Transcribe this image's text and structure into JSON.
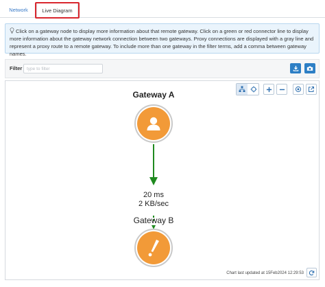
{
  "tabs": [
    {
      "label": "Network"
    },
    {
      "label": "Live Diagram"
    }
  ],
  "info": {
    "text": "Click on a gateway node to display more information about that remote gateway. Click on a green or red connector line to display more information about the gateway network connection between two gateways. Proxy connections are displayed with a gray line and represent a proxy route to a remote gateway. To include more than one gateway in the filter terms, add a comma between gateway names."
  },
  "filter": {
    "label": "Filter",
    "placeholder": "type to filter",
    "value": ""
  },
  "diagram": {
    "nodes": [
      {
        "name": "Gateway A",
        "icon": "user-icon"
      },
      {
        "name": "Gateway B",
        "icon": "warning-icon"
      }
    ],
    "connection": {
      "latency": "20 ms",
      "throughput": "2 KB/sec",
      "status_color": "#1f8a1f"
    },
    "node_color": "#f29a38",
    "footer": "Chart last updated at 15Feb2024 12:29:53"
  },
  "colors": {
    "accent": "#2d7fc5",
    "highlight": "#d9262d",
    "info_bg": "#eaf4fc"
  }
}
